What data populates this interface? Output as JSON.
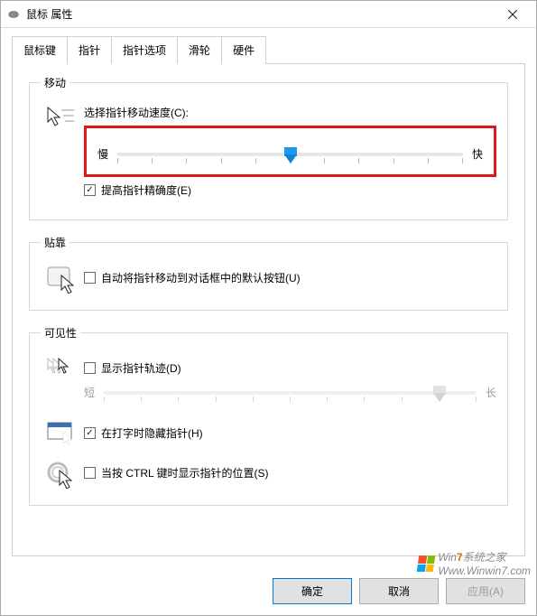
{
  "window": {
    "title": "鼠标 属性"
  },
  "tabs": [
    {
      "id": "buttons",
      "label": "鼠标键",
      "active": false
    },
    {
      "id": "pointers",
      "label": "指针",
      "active": false
    },
    {
      "id": "options",
      "label": "指针选项",
      "active": true
    },
    {
      "id": "wheel",
      "label": "滑轮",
      "active": false
    },
    {
      "id": "hardware",
      "label": "硬件",
      "active": false
    }
  ],
  "groups": {
    "motion": {
      "legend": "移动",
      "speed_label": "选择指针移动速度(C):",
      "slow": "慢",
      "fast": "快",
      "speed_value": 5,
      "speed_min": 0,
      "speed_max": 10,
      "enhance_precision": {
        "label": "提高指针精确度(E)",
        "checked": true
      }
    },
    "snapto": {
      "legend": "贴靠",
      "auto_move": {
        "label": "自动将指针移动到对话框中的默认按钮(U)",
        "checked": false
      }
    },
    "visibility": {
      "legend": "可见性",
      "trails": {
        "label": "显示指针轨迹(D)",
        "checked": false,
        "short": "短",
        "long": "长",
        "value": 9,
        "min": 0,
        "max": 10
      },
      "hide_typing": {
        "label": "在打字时隐藏指针(H)",
        "checked": true
      },
      "ctrl_locate": {
        "label": "当按 CTRL 键时显示指针的位置(S)",
        "checked": false
      }
    }
  },
  "buttons": {
    "ok": "确定",
    "cancel": "取消",
    "apply": "应用(A)"
  },
  "watermark": {
    "brand_7": "7",
    "brand_text": "系统之家",
    "brand_prefix": "Win",
    "url": "Www.Winwin7.com"
  }
}
